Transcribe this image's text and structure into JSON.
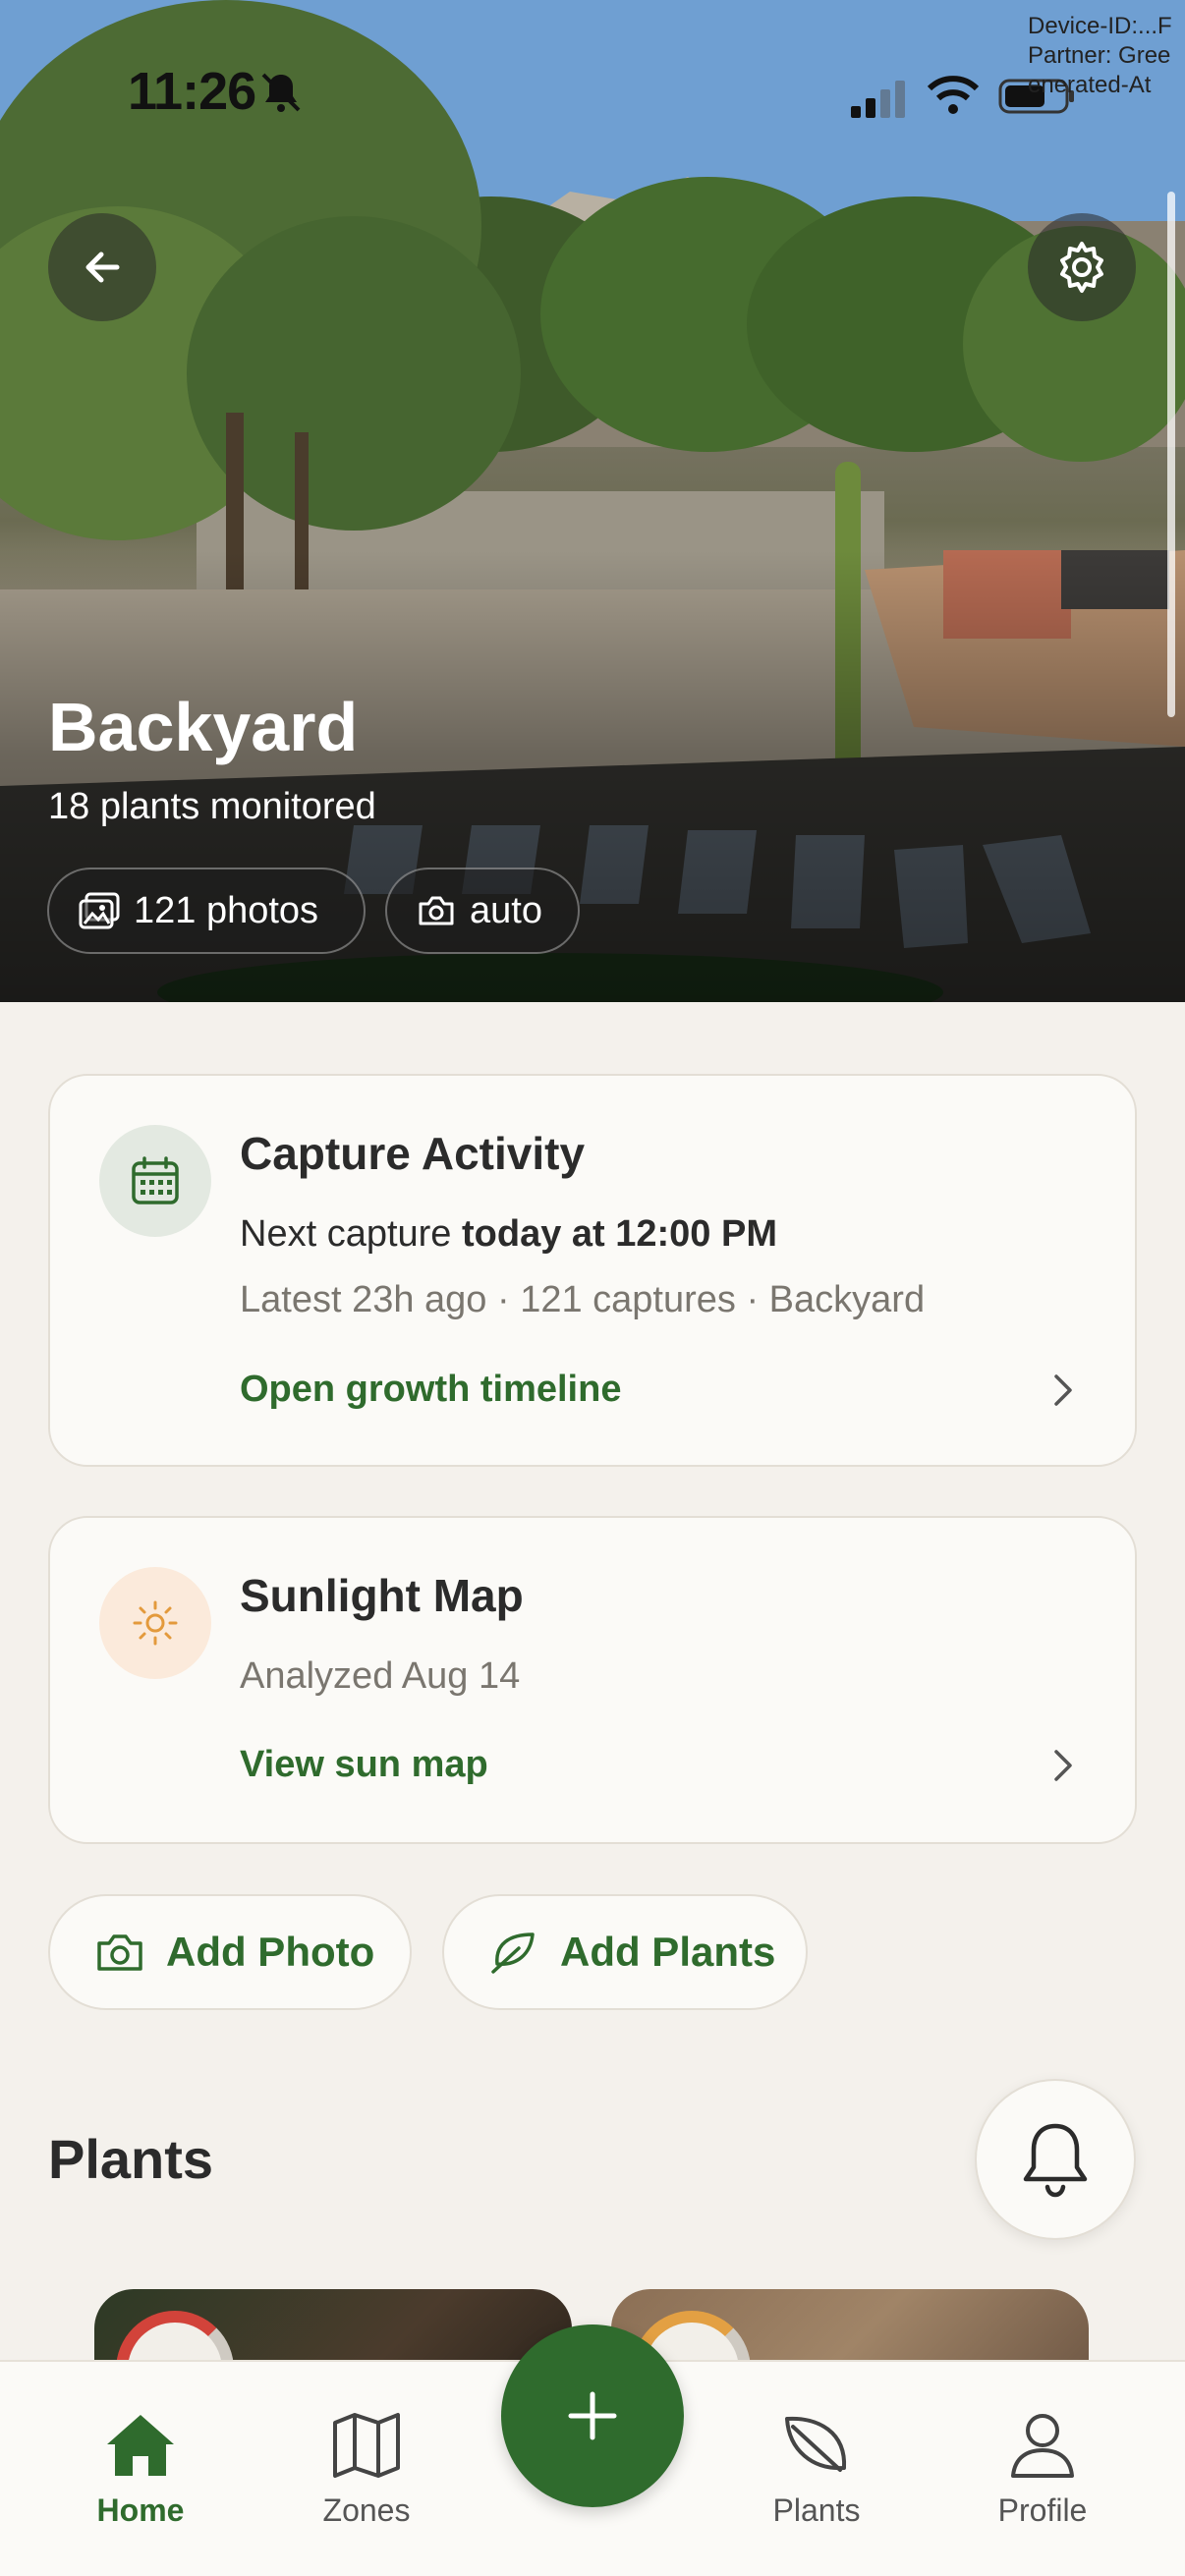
{
  "status_bar": {
    "time": "11:26",
    "overlay_lines": [
      "Device-ID:...F",
      "Partner: Gree",
      "enerated-At"
    ]
  },
  "hero": {
    "title": "Backyard",
    "subtitle": "18 plants monitored",
    "chips": {
      "photos": "121 photos",
      "mode": "auto"
    }
  },
  "capture_card": {
    "title": "Capture Activity",
    "next_prefix": "Next capture ",
    "next_value": "today at 12:00 PM",
    "latest": "Latest 23h ago · 121 captures · Backyard",
    "link": "Open growth timeline"
  },
  "sun_card": {
    "title": "Sunlight Map",
    "analyzed": "Analyzed Aug 14",
    "link": "View sun map"
  },
  "actions": {
    "add_photo": "Add Photo",
    "add_plants": "Add Plants"
  },
  "plants_section": {
    "title": "Plants"
  },
  "tabbar": {
    "home": "Home",
    "zones": "Zones",
    "plants": "Plants",
    "profile": "Profile"
  },
  "colors": {
    "accent_green": "#2f6b2d",
    "background": "#f4f1ec",
    "card": "#fbfaf7"
  },
  "icons": [
    "back-arrow-icon",
    "gear-icon",
    "photos-icon",
    "camera-icon",
    "calendar-icon",
    "sun-icon",
    "chevron-right-icon",
    "leaf-icon",
    "bell-icon",
    "home-icon",
    "map-icon",
    "plus-icon",
    "person-icon"
  ]
}
